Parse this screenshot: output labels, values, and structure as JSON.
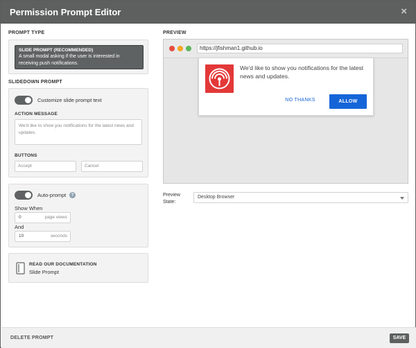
{
  "window": {
    "title": "Permission Prompt Editor",
    "close_symbol": "×"
  },
  "prompt_type": {
    "section_label": "PROMPT TYPE",
    "option_title": "SLIDE PROMPT (RECOMMENDED)",
    "option_description": "A small modal asking if the user is interested in receiving push notifications."
  },
  "slidedown": {
    "section_label": "SLIDEDOWN PROMPT",
    "customize_toggle_label": "Customize slide prompt text",
    "customize_enabled": true,
    "action_message_label": "ACTION MESSAGE",
    "action_message_value": "We'd like to show you notifications for the latest news and updates.",
    "buttons_label": "BUTTONS",
    "accept_placeholder": "Accept",
    "cancel_placeholder": "Cancel"
  },
  "autoprompt": {
    "toggle_label": "Auto-prompt",
    "enabled": true,
    "help_symbol": "?",
    "show_when_label": "Show When",
    "page_views_value": "0",
    "page_views_unit": "page views",
    "and_label": "And",
    "seconds_value": "10",
    "seconds_unit": "seconds"
  },
  "documentation": {
    "heading": "READ OUR DOCUMENTATION",
    "link_text": "Slide Prompt"
  },
  "preview": {
    "section_label": "PREVIEW",
    "url": "https://jfishman1.github.io",
    "message": "We'd like to show you notifications for the latest news and updates.",
    "no_thanks_label": "NO THANKS",
    "allow_label": "ALLOW",
    "state_label": "Preview State:",
    "state_value": "Desktop Browser"
  },
  "footer": {
    "delete_label": "DELETE PROMPT",
    "save_label": "SAVE"
  },
  "colors": {
    "titlebar": "#5e6060",
    "accent_blue": "#1565d8",
    "prompt_icon_red": "#e33838",
    "traffic_red": "#e74c3c",
    "traffic_yellow": "#f5a623",
    "traffic_green": "#5cb85c"
  },
  "icons": [
    "close-icon",
    "toggle-switch",
    "help-icon",
    "document-icon",
    "notification-bell-icon",
    "dropdown-caret-icon"
  ]
}
